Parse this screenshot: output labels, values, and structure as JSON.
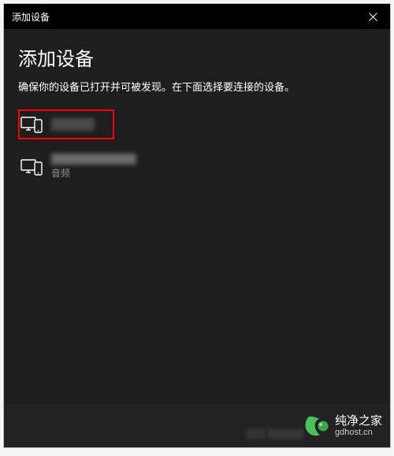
{
  "titlebar": {
    "title": "添加设备",
    "close_label": "关闭"
  },
  "dialog": {
    "heading": "添加设备",
    "subtitle": "确保你的设备已打开并可被发现。在下面选择要连接的设备。"
  },
  "devices": {
    "item0": {
      "name": "",
      "sub": ""
    },
    "item1": {
      "name": "",
      "sub": "音频"
    }
  },
  "brand": {
    "name": "纯净之家",
    "url": "gdhost.cn"
  },
  "colors": {
    "dialog_bg": "#1e1e1e",
    "titlebar_bg": "#000000",
    "highlight_border": "#ff0000",
    "brand_accent1": "#4ac25c",
    "brand_accent2": "#3aa848"
  }
}
